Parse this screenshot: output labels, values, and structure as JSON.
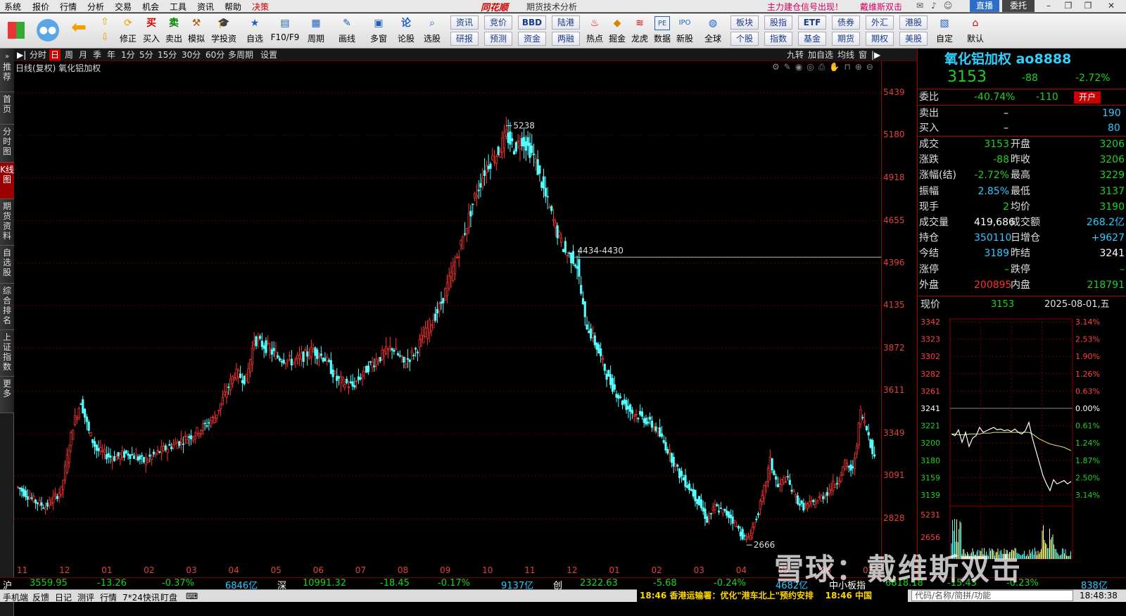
{
  "menu": {
    "items": [
      "系统",
      "报价",
      "行情",
      "分析",
      "交易",
      "机会",
      "工具",
      "资讯",
      "帮助",
      "决策"
    ],
    "brand": "同花顺",
    "app_title": "期货技术分析",
    "promo1": "主力建仓信号出现！",
    "promo2": "戴维斯双击",
    "btn_zhibo": "直播",
    "btn_weituo": "委托"
  },
  "toolbar": {
    "items": [
      "修正",
      "买入",
      "卖出",
      "模拟",
      "学投资",
      "自选",
      "F10/F9",
      "周期",
      "画线",
      "多窗",
      "论股",
      "选股"
    ],
    "grid": [
      "资讯",
      "竞价",
      "BBD",
      "陆港",
      "研报",
      "预测",
      "资金",
      "两融"
    ],
    "items2": [
      "热点",
      "掘金",
      "龙虎",
      "数据",
      "新股",
      "全球"
    ],
    "grid2": [
      "板块",
      "债券",
      "股指",
      "ETF",
      "外汇",
      "港股",
      "个股",
      "指数",
      "基金",
      "期货",
      "期权",
      "美股"
    ],
    "items3": [
      "自定",
      "默认"
    ]
  },
  "sidetabs": [
    "推荐",
    "首页",
    "分时图",
    "K线图",
    "期货资料",
    "自选股",
    "综合排名",
    "上证指数",
    "更多"
  ],
  "periods": [
    "分时",
    "日",
    "周",
    "月",
    "季",
    "年",
    "1分",
    "5分",
    "15分",
    "30分",
    "60分",
    "多周期",
    "设置"
  ],
  "period_active": "日",
  "chart_tools": [
    "九转",
    "加自选",
    "均线",
    "窗"
  ],
  "chart_title": "日线(复权)  氧化铝加权",
  "chart_data": {
    "type": "candlestick",
    "ylim": [
      2550,
      5560
    ],
    "yticks": [
      5439,
      5180,
      4918,
      4655,
      4396,
      4135,
      3872,
      3611,
      3349,
      3091,
      2828
    ],
    "xticks": [
      "11",
      "12",
      "01",
      "02",
      "03",
      "04",
      "05",
      "06",
      "07",
      "08",
      "09",
      "10",
      "11",
      "12",
      "01",
      "02",
      "03",
      "04",
      "05",
      "06",
      "07"
    ],
    "annotations": {
      "high": "5238",
      "low": "2666",
      "level": "4434-4430"
    },
    "level_value": 4432,
    "anchors": [
      [
        0,
        3020
      ],
      [
        8,
        2940
      ],
      [
        14,
        2900
      ],
      [
        22,
        3000
      ],
      [
        28,
        3400
      ],
      [
        32,
        3550
      ],
      [
        36,
        3360
      ],
      [
        40,
        3250
      ],
      [
        48,
        3200
      ],
      [
        56,
        3230
      ],
      [
        64,
        3180
      ],
      [
        72,
        3240
      ],
      [
        82,
        3300
      ],
      [
        90,
        3350
      ],
      [
        100,
        3450
      ],
      [
        110,
        3720
      ],
      [
        116,
        3680
      ],
      [
        120,
        3930
      ],
      [
        126,
        3880
      ],
      [
        132,
        3820
      ],
      [
        140,
        3790
      ],
      [
        150,
        3860
      ],
      [
        156,
        3810
      ],
      [
        162,
        3680
      ],
      [
        170,
        3640
      ],
      [
        178,
        3760
      ],
      [
        184,
        3820
      ],
      [
        190,
        3880
      ],
      [
        196,
        3780
      ],
      [
        202,
        3860
      ],
      [
        208,
        3990
      ],
      [
        214,
        4120
      ],
      [
        220,
        4320
      ],
      [
        226,
        4550
      ],
      [
        232,
        4800
      ],
      [
        238,
        4990
      ],
      [
        244,
        5080
      ],
      [
        248,
        5180
      ],
      [
        252,
        5100
      ],
      [
        256,
        5160
      ],
      [
        262,
        5050
      ],
      [
        268,
        4800
      ],
      [
        274,
        4580
      ],
      [
        278,
        4460
      ],
      [
        282,
        4420
      ],
      [
        284,
        4380
      ],
      [
        288,
        4040
      ],
      [
        294,
        3880
      ],
      [
        300,
        3680
      ],
      [
        306,
        3560
      ],
      [
        312,
        3480
      ],
      [
        318,
        3440
      ],
      [
        324,
        3380
      ],
      [
        330,
        3250
      ],
      [
        336,
        3100
      ],
      [
        342,
        3000
      ],
      [
        346,
        2920
      ],
      [
        350,
        2820
      ],
      [
        354,
        2900
      ],
      [
        358,
        2870
      ],
      [
        362,
        2840
      ],
      [
        366,
        2760
      ],
      [
        370,
        2690
      ],
      [
        374,
        2800
      ],
      [
        378,
        2950
      ],
      [
        382,
        3180
      ],
      [
        386,
        3020
      ],
      [
        390,
        3080
      ],
      [
        394,
        2980
      ],
      [
        398,
        2900
      ],
      [
        404,
        2920
      ],
      [
        410,
        2980
      ],
      [
        416,
        3060
      ],
      [
        420,
        3160
      ],
      [
        424,
        3120
      ],
      [
        428,
        3480
      ],
      [
        432,
        3340
      ],
      [
        435,
        3200
      ]
    ]
  },
  "quote": {
    "name": "氧化铝加权 ao8888",
    "price": "3153",
    "change": "-88",
    "pct": "-2.72%",
    "weibi_lab": "委比",
    "weibi": "-40.74%",
    "weicha": "-110",
    "kaihu": "开户",
    "sell_lab": "卖出",
    "sell_price": "–",
    "sell_vol": "190",
    "buy_lab": "买入",
    "buy_price": "–",
    "buy_vol": "80",
    "rows": [
      [
        "成交",
        "3153",
        "开盘",
        "3206"
      ],
      [
        "涨跌",
        "-88",
        "昨收",
        "3206"
      ],
      [
        "涨幅(结)",
        "-2.72%",
        "最高",
        "3229"
      ],
      [
        "振幅",
        "2.85%",
        "最低",
        "3137"
      ],
      [
        "现手",
        "2",
        "均价",
        "3190"
      ],
      [
        "成交量",
        "419,686",
        "成交额",
        "268.2亿"
      ],
      [
        "持仓",
        "350110",
        "日增仓",
        "+9627"
      ],
      [
        "今结",
        "3189",
        "昨结",
        "3241"
      ],
      [
        "涨停",
        "–",
        "跌停",
        "–"
      ],
      [
        "外盘",
        "200895",
        "内盘",
        "218791"
      ]
    ],
    "now_lab": "现价",
    "now_price": "3153",
    "date": "2025-08-01,五"
  },
  "mini_chart": {
    "type": "line",
    "ylim": [
      3130,
      3345
    ],
    "base": 3241,
    "left_ticks": [
      "3342",
      "3323",
      "3302",
      "3282",
      "3261",
      "3241",
      "3221",
      "3200",
      "3180",
      "3159",
      "3139"
    ],
    "right_ticks": [
      "3.14%",
      "2.53%",
      "1.90%",
      "1.26%",
      "0.63%",
      "0.00%",
      "0.61%",
      "1.24%",
      "1.87%",
      "2.50%",
      "3.14%"
    ],
    "vol_ticks": [
      "5231",
      "2656"
    ],
    "price": [
      3210,
      3208,
      3215,
      3200,
      3212,
      3195,
      3205,
      3208,
      3218,
      3212,
      3214,
      3216,
      3218,
      3215,
      3216,
      3214,
      3215,
      3213,
      3216,
      3212,
      3210,
      3214,
      3224,
      3205,
      3190,
      3175,
      3160,
      3150,
      3142,
      3155,
      3150,
      3152,
      3154,
      3150,
      3153
    ],
    "avg": [
      3210,
      3210,
      3209,
      3209,
      3209,
      3210,
      3210,
      3210,
      3210,
      3211,
      3211,
      3211,
      3212,
      3212,
      3212,
      3212,
      3212,
      3212,
      3212,
      3212,
      3212,
      3212,
      3212,
      3210,
      3207,
      3204,
      3202,
      3200,
      3198,
      3197,
      3196,
      3195,
      3194,
      3192,
      3190
    ]
  },
  "index_bar": {
    "sh_lab": "沪",
    "sh": "3559.95",
    "sh_chg": "-13.26",
    "sh_pct": "-0.37%",
    "sh_amt": "6846亿",
    "sz_lab": "深",
    "sz": "10991.32",
    "sz_chg": "-18.45",
    "sz_pct": "-0.17%",
    "sz_amt": "9137亿",
    "cy_lab": "创",
    "cy": "2322.63",
    "cy_chg": "-5.68",
    "cy_pct": "-0.24%",
    "cy_amt": "4682亿",
    "zx_lab": "中小板指",
    "zx": "6818.18",
    "zx_chg": "-15.43",
    "zx_pct": "-0.23%",
    "zx_amt": "838亿"
  },
  "status": {
    "items": [
      "手机端",
      "反馈",
      "日记",
      "测评",
      "行情",
      "7*24快讯",
      "盯盘"
    ],
    "news1": "18:46 香港运输署：优化\"港车北上\"预约安排",
    "news2": "18:46 中国",
    "search_placeholder": "代码/名称/简拼/功能",
    "clock": "18:48:38"
  },
  "watermark": "雪球：戴维斯双击"
}
